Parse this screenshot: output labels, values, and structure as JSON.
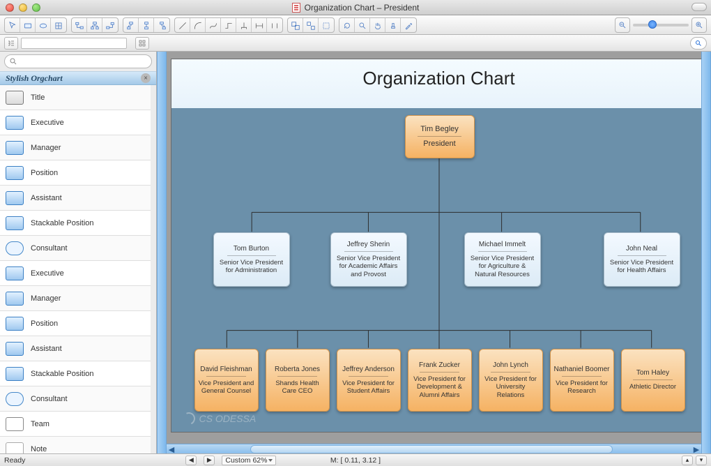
{
  "window": {
    "title": "Organization Chart – President"
  },
  "sidebar": {
    "group_title": "Stylish Orgchart",
    "search_placeholder": "",
    "items": [
      {
        "label": "Title",
        "icon": "title"
      },
      {
        "label": "Executive",
        "icon": "box"
      },
      {
        "label": "Manager",
        "icon": "box"
      },
      {
        "label": "Position",
        "icon": "box"
      },
      {
        "label": "Assistant",
        "icon": "box"
      },
      {
        "label": "Stackable Position",
        "icon": "stack"
      },
      {
        "label": "Consultant",
        "icon": "consultant"
      },
      {
        "label": "Executive",
        "icon": "box"
      },
      {
        "label": "Manager",
        "icon": "box"
      },
      {
        "label": "Position",
        "icon": "box"
      },
      {
        "label": "Assistant",
        "icon": "box"
      },
      {
        "label": "Stackable Position",
        "icon": "stack"
      },
      {
        "label": "Consultant",
        "icon": "consultant"
      },
      {
        "label": "Team",
        "icon": "team"
      },
      {
        "label": "Note",
        "icon": "note"
      }
    ]
  },
  "canvas": {
    "title": "Organization Chart",
    "watermark": "CS ODESSA"
  },
  "chart_data": {
    "type": "org-chart",
    "levels": [
      {
        "level": 1,
        "nodes": [
          {
            "id": "n0",
            "name": "Tim Begley",
            "role": "President",
            "style": "orange"
          }
        ]
      },
      {
        "level": 2,
        "parent": "n0",
        "nodes": [
          {
            "id": "n1",
            "name": "Tom Burton",
            "role": "Senior Vice President for Administration",
            "style": "blue"
          },
          {
            "id": "n2",
            "name": "Jeffrey Sherin",
            "role": "Senior Vice President for Academic Affairs and Provost",
            "style": "blue"
          },
          {
            "id": "n3",
            "name": "Michael Immelt",
            "role": "Senior Vice President for Agriculture & Natural Resources",
            "style": "blue"
          },
          {
            "id": "n4",
            "name": "John Neal",
            "role": "Senior Vice President for Health Affairs",
            "style": "blue"
          }
        ]
      },
      {
        "level": 3,
        "parent": "n0",
        "nodes": [
          {
            "id": "n5",
            "name": "David Fleishman",
            "role": "Vice President and General Counsel",
            "style": "orange"
          },
          {
            "id": "n6",
            "name": "Roberta Jones",
            "role": "Shands Health Care CEO",
            "style": "orange"
          },
          {
            "id": "n7",
            "name": "Jeffrey Anderson",
            "role": "Vice President for Student Affairs",
            "style": "orange"
          },
          {
            "id": "n8",
            "name": "Frank Zucker",
            "role": "Vice President for Development & Alumni Affairs",
            "style": "orange"
          },
          {
            "id": "n9",
            "name": "John Lynch",
            "role": "Vice President for University Relations",
            "style": "orange"
          },
          {
            "id": "n10",
            "name": "Nathaniel Boomer",
            "role": "Vice President for Research",
            "style": "orange"
          },
          {
            "id": "n11",
            "name": "Tom Haley",
            "role": "Athletic Director",
            "style": "orange"
          }
        ]
      }
    ]
  },
  "status": {
    "ready": "Ready",
    "zoom_label": "Custom 62%",
    "mouse": "M: [ 0.11, 3.12 ]"
  }
}
